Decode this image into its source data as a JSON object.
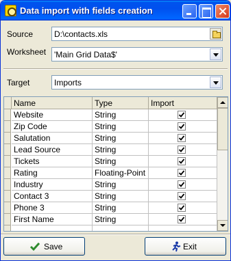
{
  "window": {
    "title": "Data import with fields creation"
  },
  "form": {
    "source_label": "Source",
    "source_value": "D:\\contacts.xls",
    "worksheet_label": "Worksheet",
    "worksheet_value": "'Main Grid Data$'",
    "target_label": "Target",
    "target_value": "Imports"
  },
  "grid": {
    "columns": [
      "Name",
      "Type",
      "Import"
    ],
    "rows": [
      {
        "name": "Website",
        "type": "String",
        "import": true
      },
      {
        "name": "Zip Code",
        "type": "String",
        "import": true
      },
      {
        "name": "Salutation",
        "type": "String",
        "import": true
      },
      {
        "name": "Lead Source",
        "type": "String",
        "import": true
      },
      {
        "name": "Tickets",
        "type": "String",
        "import": true
      },
      {
        "name": "Rating",
        "type": "Floating-Point",
        "import": true
      },
      {
        "name": "Industry",
        "type": "String",
        "import": true
      },
      {
        "name": "Contact 3",
        "type": "String",
        "import": true
      },
      {
        "name": "Phone 3",
        "type": "String",
        "import": true
      },
      {
        "name": "First Name",
        "type": "String",
        "import": true
      }
    ]
  },
  "buttons": {
    "save": "Save",
    "exit": "Exit"
  },
  "icons": {
    "check": "checkmark-icon",
    "exit": "running-man-icon"
  },
  "colors": {
    "titlebar": "#0054e3",
    "dialog_bg": "#ece9d8",
    "check_green": "#2e8b2e"
  }
}
